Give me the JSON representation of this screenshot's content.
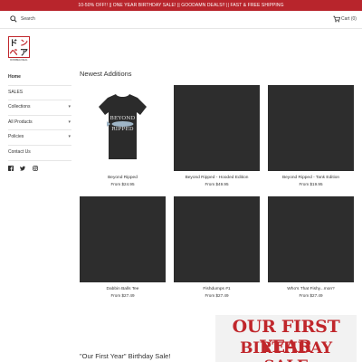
{
  "banner": {
    "text": "10-50% OFF!! || ONE YEAR BIRTHDAY SALE! || GOODAMN DEALS!! || FAST & FREE SHIPPING"
  },
  "header": {
    "search_label": "Search",
    "cart_label": "Cart (0)"
  },
  "logo": {
    "glyphs": "ドン\nベア",
    "caption": "DONBEA DEAL"
  },
  "sidebar": {
    "items": [
      {
        "label": "Home",
        "active": true,
        "has_dropdown": false
      },
      {
        "label": "SALES",
        "active": false,
        "has_dropdown": false
      },
      {
        "label": "Collections",
        "active": false,
        "has_dropdown": true
      },
      {
        "label": "All Products",
        "active": false,
        "has_dropdown": true
      },
      {
        "label": "Policies",
        "active": false,
        "has_dropdown": true
      },
      {
        "label": "Contact Us",
        "active": false,
        "has_dropdown": false
      }
    ],
    "social": [
      "facebook-icon",
      "twitter-icon",
      "instagram-icon"
    ]
  },
  "main": {
    "section_title": "Newest Additions",
    "products": [
      {
        "name": "Beyond Ripped",
        "price": "From $24.95",
        "image_text": "BEYOND\nRIPPED"
      },
      {
        "name": "Beyond Ripped - Hooded Edition",
        "price": "From $49.95"
      },
      {
        "name": "Beyond Ripped - Tank Edition",
        "price": "From $19.95"
      },
      {
        "name": "Dabbin Balls Tee",
        "price": "From $27.49"
      },
      {
        "name": "Fishdumps #1",
        "price": "From $27.49"
      },
      {
        "name": "Who's That Fishy...mon?",
        "price": "From $27.49"
      }
    ],
    "birthday_title": "\"Our First Year\" Birthday Sale!",
    "birthday_image": {
      "line1": "OUR FIRST YEAR",
      "line2": "BIRTHDAY SALE"
    }
  },
  "colors": {
    "banner_bg": "#b8252c",
    "accent_red": "#c0262b",
    "product_dark": "#2d2d2d"
  }
}
